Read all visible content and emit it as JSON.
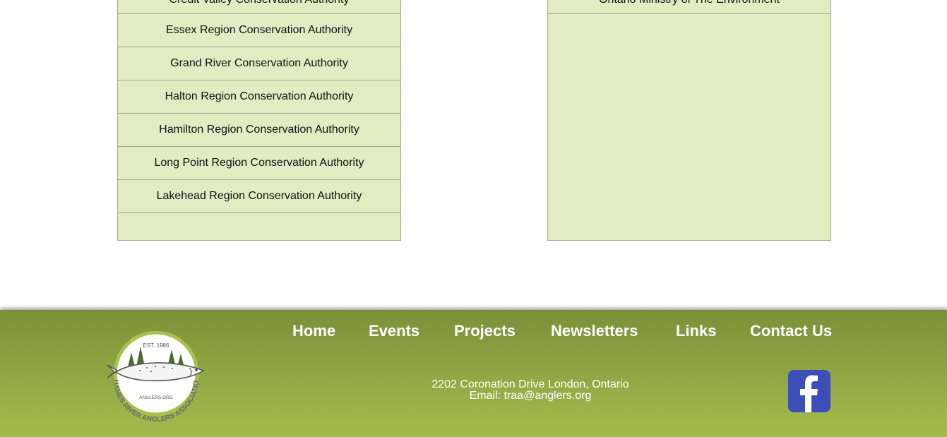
{
  "left_list": {
    "items": [
      "Credit Valley Conservation Authority",
      "Essex Region Conservation Authority",
      "Grand River Conservation Authority",
      "Halton Region Conservation Authority",
      "Hamilton Region Conservation Authority",
      "Long Point Region Conservation Authority",
      "Lakehead Region Conservation Authority"
    ]
  },
  "right_list": {
    "items": [
      "Ontario Ministry of The Environment"
    ]
  },
  "footer": {
    "nav": [
      "Home",
      "Events",
      "Projects",
      "Newsletters",
      "Links",
      "Contact Us"
    ],
    "address_line": "2202 Coronation Drive London, Ontario",
    "email_line": "Email: traa@anglers.org",
    "logo": {
      "est": "EST. 1986",
      "site": "ANGLERS.ORG",
      "name": "THAMES RIVER ANGLERS ASSOCIATION"
    },
    "facebook_icon": "facebook-icon"
  },
  "colors": {
    "panel_bg": "#e2ebc2",
    "footer_top": "#7c9038",
    "footer_bottom": "#a4bc4d",
    "facebook_blue": "#3c4fb6"
  }
}
